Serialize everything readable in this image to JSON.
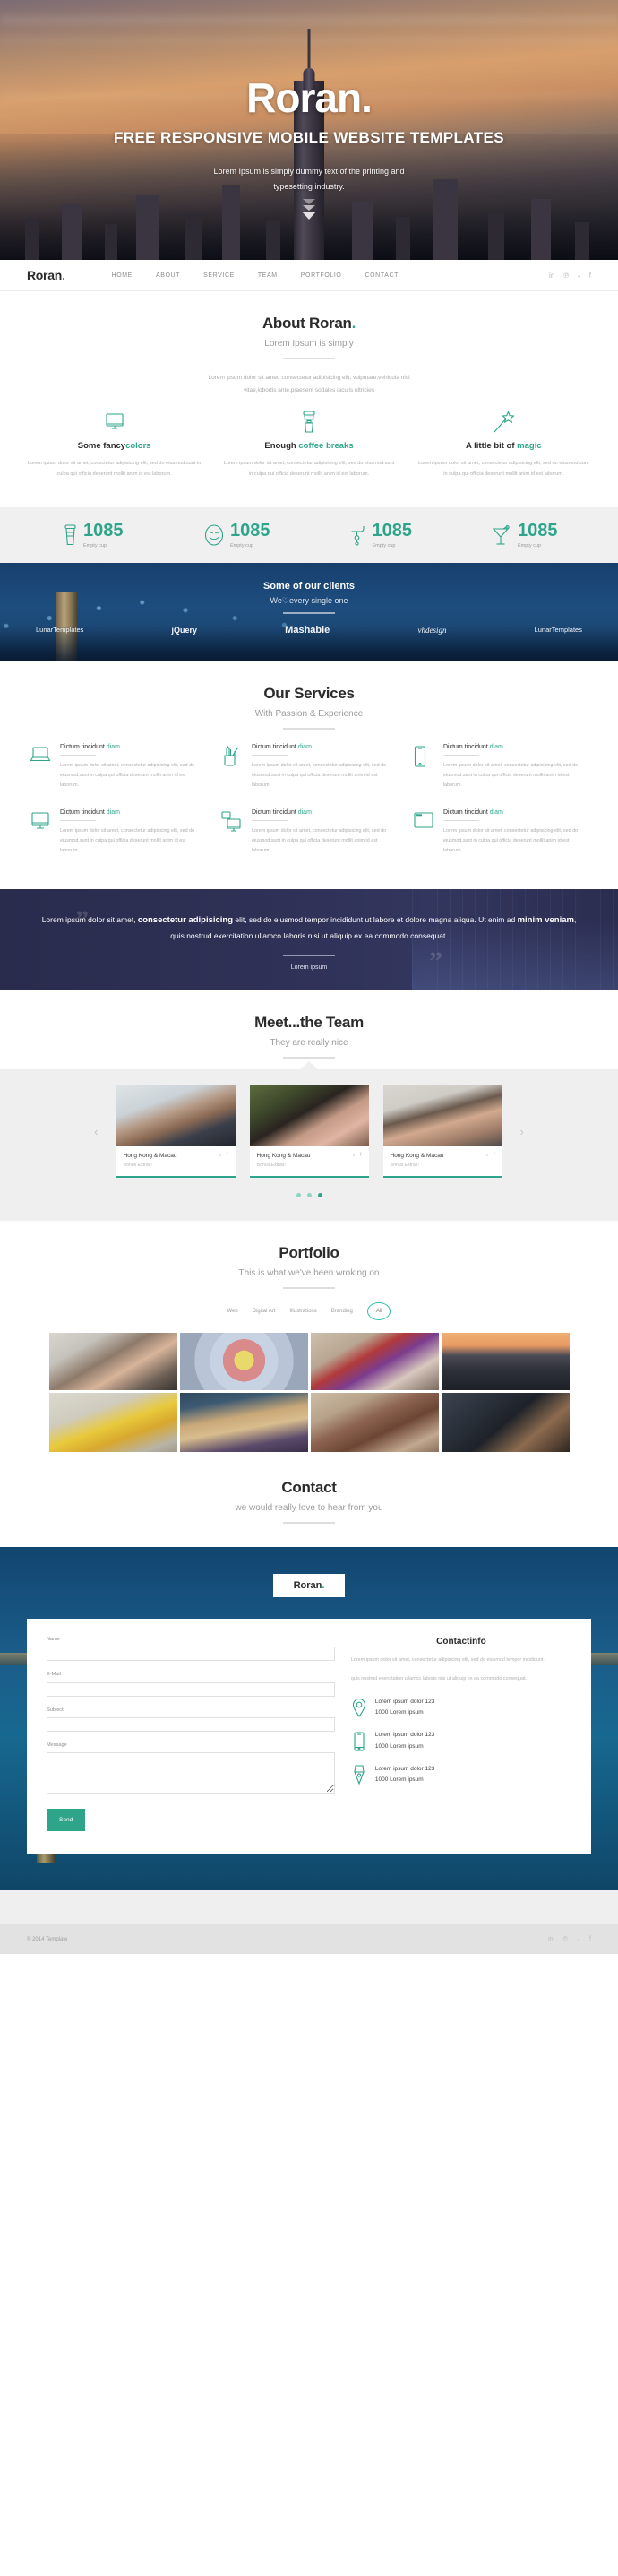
{
  "brand": {
    "name": "Roran",
    "dot": "."
  },
  "hero": {
    "title": "Roran",
    "title_dot": ".",
    "subtitle": "FREE RESPONSIVE MOBILE WEBSITE TEMPLATES",
    "text_line1": "Lorem Ipsum is simply dummy text of the printing and",
    "text_line2": "typesetting industry."
  },
  "nav": {
    "items": [
      {
        "label": "HOME"
      },
      {
        "label": "ABOUT"
      },
      {
        "label": "SERVICE"
      },
      {
        "label": "TEAM"
      },
      {
        "label": "PORTFOLIO"
      },
      {
        "label": "CONTACT"
      }
    ],
    "social": [
      {
        "glyph": "in",
        "name": "linkedin"
      },
      {
        "glyph": "℗",
        "name": "pinterest"
      },
      {
        "glyph": "ᵥ",
        "name": "twitter"
      },
      {
        "glyph": "f",
        "name": "facebook"
      }
    ]
  },
  "about": {
    "title": "About Roran",
    "title_dot": ".",
    "subtitle": "Lorem Ipsum is simply",
    "lead_line1": "Lorem ipsum dolor sit amet, consectetur adipisicing elit, vulputate,vehicula nisi",
    "lead_line2": "vitae,lobortis ante.praesent sodales iaculis ultricies",
    "features": [
      {
        "icon": "monitor-icon",
        "title_dark": "Some fancy",
        "title_teal": "colors",
        "body": "Lorem ipsum dolor sit amet, consctetur adipisicing elit, sed do eiusmod.sunt in culpa qui officia deserunt mollit anim id est laborum."
      },
      {
        "icon": "coffee-cup-icon",
        "title_dark": "Enough ",
        "title_teal": "coffee breaks",
        "body": "Lorem ipsum dolor sit amet, consectetur adipisicing elit, sed do eiusmod.sunt in culpa qui officia deserunt mollit anim id est laborum."
      },
      {
        "icon": "magic-wand-icon",
        "title_dark": "A little bit of ",
        "title_teal": "magic",
        "body": "Lorem ipsum dolor sit amet, consectetur adipisicing elit, sed do eiusmod.sunt in culpa qui officia deserunt mollit anim id est laborum."
      }
    ]
  },
  "counters": [
    {
      "icon": "coffee-cup-icon",
      "value": "1085",
      "label": "Empty cup"
    },
    {
      "icon": "smiley-icon",
      "value": "1085",
      "label": "Empty cup"
    },
    {
      "icon": "hookah-icon",
      "value": "1085",
      "label": "Empty cup"
    },
    {
      "icon": "cocktail-icon",
      "value": "1085",
      "label": "Empty cup"
    }
  ],
  "clients": {
    "title": "Some of our clients",
    "subtitle_pre": "We",
    "subtitle_heart": "♡",
    "subtitle_post": "every single one",
    "logos": [
      {
        "name": "LunarTemplates"
      },
      {
        "name": "jQuery"
      },
      {
        "name": "Mashable"
      },
      {
        "name": "vhdesign"
      },
      {
        "name": "LunarTemplates"
      }
    ]
  },
  "services": {
    "title": "Our Services",
    "subtitle": "With Passion & Experience",
    "items": [
      {
        "icon": "laptop-icon",
        "title": "Dictum tincidunt",
        "title_teal": "diam",
        "body": "Lorem ipsum dolor sit amet, consectetur adipisicing elit, sed do eiusmod.sunt in culpa qui officia deserunt mollit anim id est laborum."
      },
      {
        "icon": "pencil-cup-icon",
        "title": "Dictum tincidunt",
        "title_teal": "diam",
        "body": "Lorem ipsum dolor sit amet, consectetur adipisicing elit, sed do eiusmod.sunt in culpa qui officia deserunt mollit anim id est laborum."
      },
      {
        "icon": "mobile-phone-icon",
        "title": "Dictum tincidunt",
        "title_teal": "diam",
        "body": "Lorem ipsum dolor sit amet, consectetur adipisicing elit, sed do eiusmod.sunt in culpa qui officia deserunt mollit anim id est laborum."
      },
      {
        "icon": "desktop-monitor-icon",
        "title": "Dictum tincidunt",
        "title_teal": "diam",
        "body": "Lorem ipsum dolor sit amet, consectetur adipisicing elit, sed do eiusmod.sunt in culpa qui officia deserunt mollit anim id est laborum."
      },
      {
        "icon": "responsive-devices-icon",
        "title": "Dictum tincidunt",
        "title_teal": "diam",
        "body": "Lorem ipsum dolor sit amet, consectetur adipisicing elit, sed do eiusmod.sunt in culpa qui officia deserunt mollit anim id est laborum."
      },
      {
        "icon": "browser-window-icon",
        "title": "Dictum tincidunt",
        "title_teal": "diam",
        "body": "Lorem ipsum dolor sit amet, consectetur adipisicing elit, sed do eiusmod.sunt in culpa qui officia deserunt mollit anim id est laborum."
      }
    ]
  },
  "quote": {
    "part1": "Lorem ipsum dolor sit amet, ",
    "bold1": "consectetur adipisicing",
    "part2": " elit, sed do eiusmod tempor incididunt ut labore et dolore magna aliqua. Ut enim ad ",
    "bold2": "minim veniam",
    "part3": ", quis nostrud exercitation ullamco laboris nisi ut aliquip ex ea commodo consequat.",
    "author": "Lorem ipsum",
    "mark": "”"
  },
  "team": {
    "title": "Meet...the Team",
    "subtitle": "They are really nice",
    "prev_arrow": "‹",
    "next_arrow": "›",
    "members": [
      {
        "name": "Hong Kong & Macau",
        "role": "Bonus Extras!",
        "social": [
          "ᵥ",
          "f"
        ]
      },
      {
        "name": "Hong Kong & Macau",
        "role": "Bonus Extras!",
        "social": [
          "ᵥ",
          "f"
        ]
      },
      {
        "name": "Hong Kong & Macau",
        "role": "Bonus Extras!",
        "social": [
          "ᵥ",
          "f"
        ]
      }
    ],
    "dots": 3,
    "active_dot": 3
  },
  "portfolio": {
    "title": "Portfolio",
    "subtitle": "This is what we've been wroking on",
    "filters": [
      {
        "label": "Web",
        "active": false
      },
      {
        "label": "Digital Art",
        "active": false
      },
      {
        "label": "Illustrations",
        "active": false
      },
      {
        "label": "Branding",
        "active": false
      },
      {
        "label": "All",
        "active": true
      }
    ],
    "items_count": 8
  },
  "contact": {
    "title": "Contact",
    "subtitle": "we would really love to hear from you",
    "badge": "Roran",
    "badge_dot": ".",
    "form": {
      "fields": [
        {
          "label": "Name",
          "value": "",
          "type": "text"
        },
        {
          "label": "E-Mail",
          "value": "",
          "type": "text"
        },
        {
          "label": "Subject",
          "value": "",
          "type": "text"
        },
        {
          "label": "Message",
          "value": "",
          "type": "textarea"
        }
      ],
      "submit_label": "Send"
    },
    "info": {
      "heading": "Contactinfo",
      "para1": "Lorem ipsum dolor sit amet, consectetur adipisicing elit, sed do eiusmod tempor incididunt.",
      "para2": "quis nostrud exercitation ullamco laboris nisi ut aliquip ex ea commodo consequat.",
      "rows": [
        {
          "icon": "map-pin-icon",
          "line1": "Lorem ipsum dolor 123",
          "line2": "1000 Lorem ipsum"
        },
        {
          "icon": "mobile-phone-icon",
          "line1": "Lorem ipsum dolor 123",
          "line2": "1000 Lorem ipsum"
        },
        {
          "icon": "pen-nib-icon",
          "line1": "Lorem ipsum dolor 123",
          "line2": "1000 Lorem ipsum"
        }
      ]
    }
  },
  "footer": {
    "copyright": "© 2014 Template",
    "social": [
      {
        "glyph": "in",
        "name": "linkedin"
      },
      {
        "glyph": "℗",
        "name": "pinterest"
      },
      {
        "glyph": "ᵥ",
        "name": "twitter"
      },
      {
        "glyph": "f",
        "name": "facebook"
      }
    ]
  },
  "colors": {
    "accent": "#2ea58a",
    "dark_navy": "#2d3055",
    "blue": "#17406e"
  }
}
